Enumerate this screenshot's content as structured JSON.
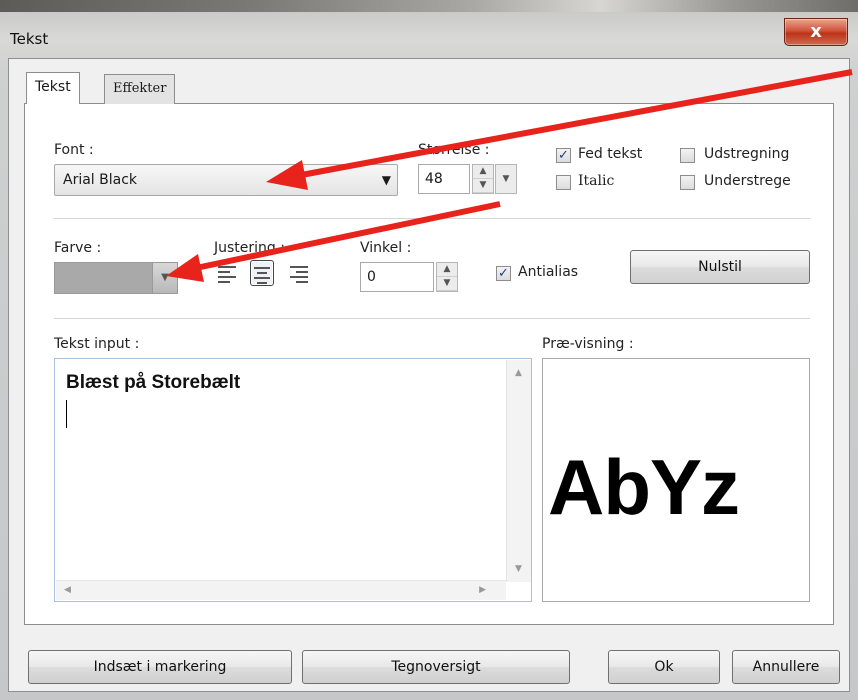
{
  "window": {
    "title": "Tekst",
    "close_glyph": "x"
  },
  "tabs": [
    {
      "label": "Tekst"
    },
    {
      "label": "Effekter"
    }
  ],
  "font": {
    "label": "Font :",
    "value": "Arial Black"
  },
  "size": {
    "label": "Størrelse :",
    "value": "48"
  },
  "style_options": {
    "bold": {
      "label": "Fed tekst",
      "checked": true
    },
    "italic": {
      "label": "Italic",
      "checked": false
    },
    "strike": {
      "label": "Udstregning",
      "checked": false
    },
    "underline": {
      "label": "Understrege",
      "checked": false
    }
  },
  "color": {
    "label": "Farve :",
    "value": "#a9a9a9"
  },
  "justify": {
    "label": "Justering :",
    "selected": "center"
  },
  "angle": {
    "label": "Vinkel :",
    "value": "0"
  },
  "antialias": {
    "label": "Antialias",
    "checked": true
  },
  "reset_button": "Nulstil",
  "text_input": {
    "label": "Tekst input :",
    "value": "Blæst på Storebælt"
  },
  "preview": {
    "label": "Præ-visning :",
    "sample": "AbYz"
  },
  "buttons": {
    "insert": "Indsæt i markering",
    "charmap": "Tegnoversigt",
    "ok": "Ok",
    "cancel": "Annullere"
  },
  "annotation_color": "#e8231b"
}
